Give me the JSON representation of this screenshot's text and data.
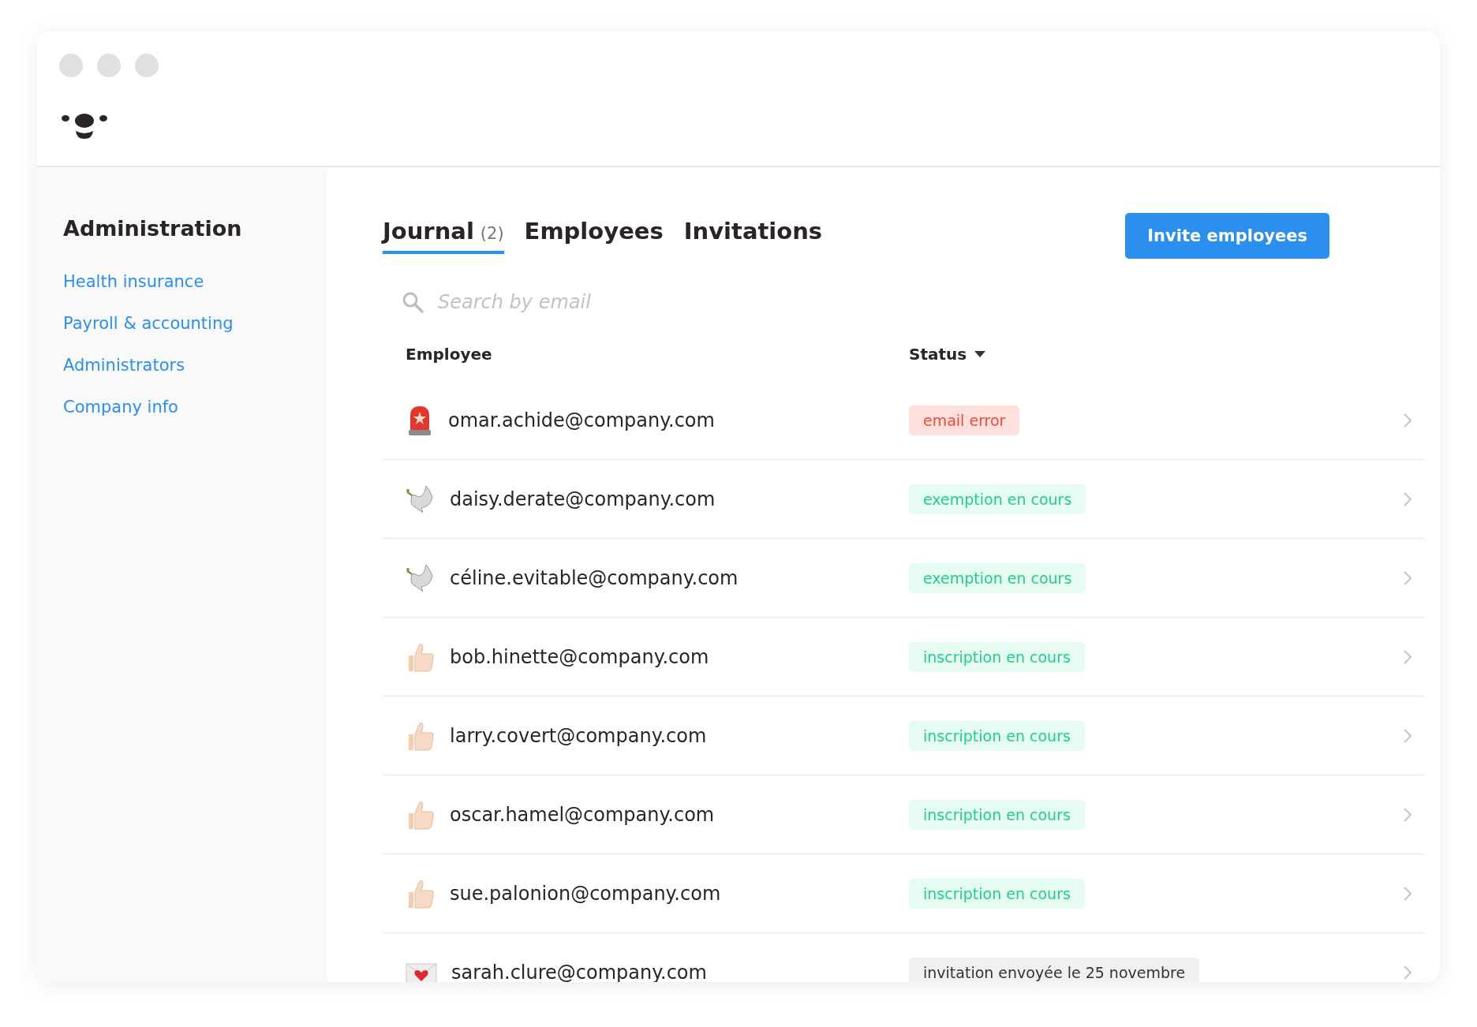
{
  "sidebar": {
    "title": "Administration",
    "items": [
      {
        "label": "Health insurance"
      },
      {
        "label": "Payroll & accounting"
      },
      {
        "label": "Administrators"
      },
      {
        "label": "Company info"
      }
    ]
  },
  "tabs": [
    {
      "label": "Journal",
      "count": "(2)",
      "selected": true
    },
    {
      "label": "Employees",
      "selected": false
    },
    {
      "label": "Invitations",
      "selected": false
    }
  ],
  "invite_button": "Invite employees",
  "search": {
    "placeholder": "Search by email"
  },
  "table": {
    "columns": [
      "Employee",
      "Status"
    ],
    "rows": [
      {
        "kind": "alarm",
        "email": "omar.achide@company.com",
        "status": {
          "label": "email error",
          "kind": "error"
        }
      },
      {
        "kind": "dove",
        "email": "daisy.derate@company.com",
        "status": {
          "label": "exemption en cours",
          "kind": "progress"
        }
      },
      {
        "kind": "dove",
        "email": "céline.evitable@company.com",
        "status": {
          "label": "exemption en cours",
          "kind": "progress"
        }
      },
      {
        "kind": "thumb",
        "email": "bob.hinette@company.com",
        "status": {
          "label": "inscription en cours",
          "kind": "progress"
        }
      },
      {
        "kind": "thumb",
        "email": "larry.covert@company.com",
        "status": {
          "label": "inscription en cours",
          "kind": "progress"
        }
      },
      {
        "kind": "thumb",
        "email": "oscar.hamel@company.com",
        "status": {
          "label": "inscription en cours",
          "kind": "progress"
        }
      },
      {
        "kind": "thumb",
        "email": "sue.palonion@company.com",
        "status": {
          "label": "inscription en cours",
          "kind": "progress"
        }
      },
      {
        "kind": "letter",
        "email": "sarah.clure@company.com",
        "status": {
          "label": "invitation envoyée le 25 novembre",
          "kind": "neutral"
        }
      }
    ]
  }
}
